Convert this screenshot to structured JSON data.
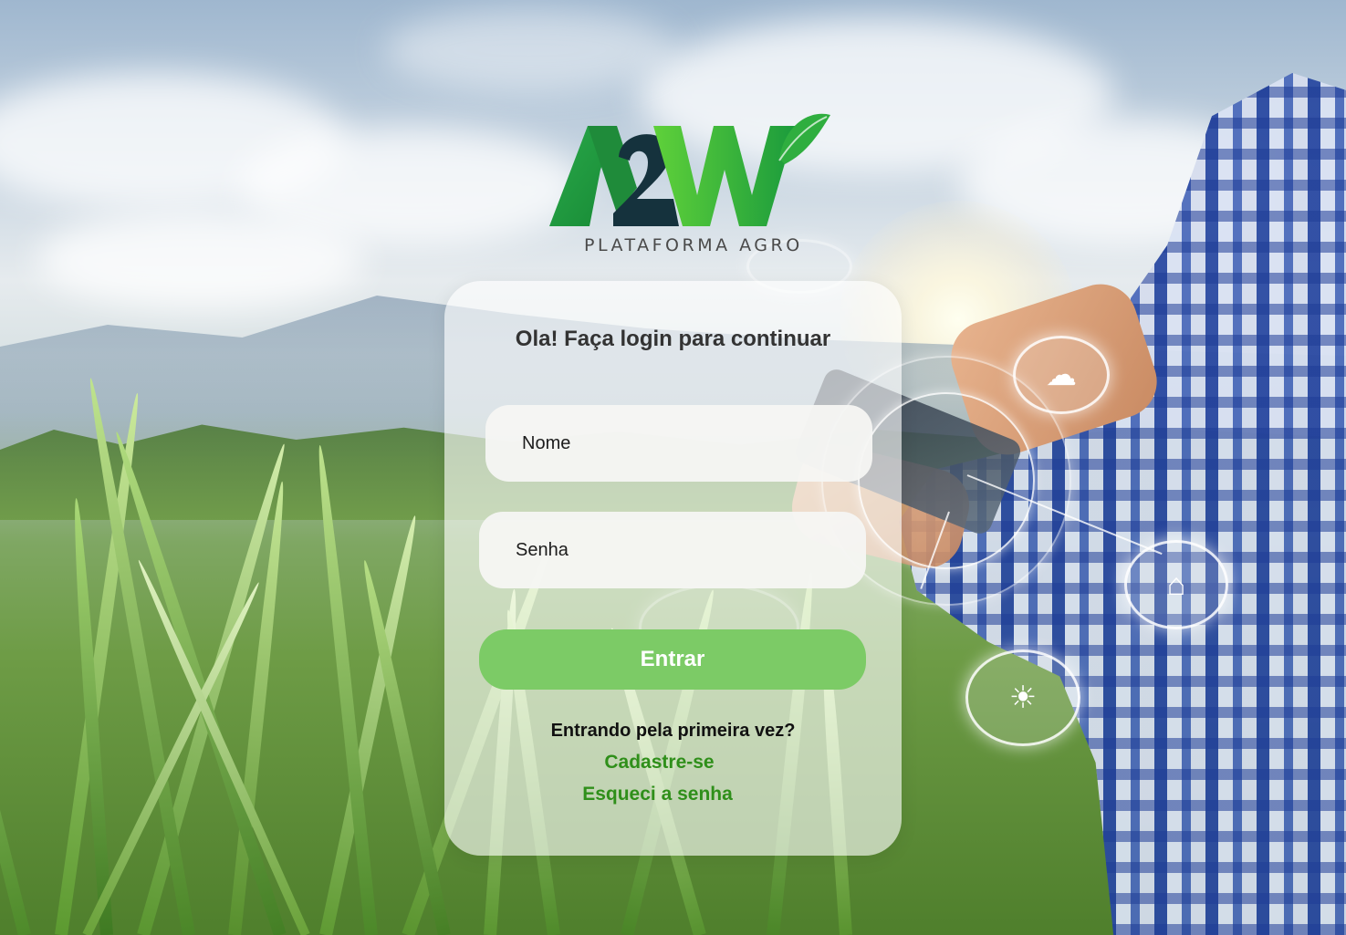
{
  "brand": {
    "logo_text": "A2W",
    "tagline": "PLATAFORMA AGRO",
    "colors": {
      "green_dark": "#1f8b3a",
      "green_light": "#4cc036",
      "navy": "#15323d"
    }
  },
  "login": {
    "heading": "Ola! Faça login para continuar",
    "name_placeholder": "Nome",
    "password_placeholder": "Senha",
    "submit_label": "Entrar",
    "first_time_text": "Entrando pela primeira vez?",
    "register_link": "Cadastre-se",
    "forgot_link": "Esqueci a senha",
    "colors": {
      "button": "#7ccb66",
      "link": "#2f8f1a"
    }
  },
  "background": {
    "icons": [
      "weather-icon",
      "sun-icon",
      "barn-icon",
      "plant-icon",
      "money-icon"
    ]
  }
}
